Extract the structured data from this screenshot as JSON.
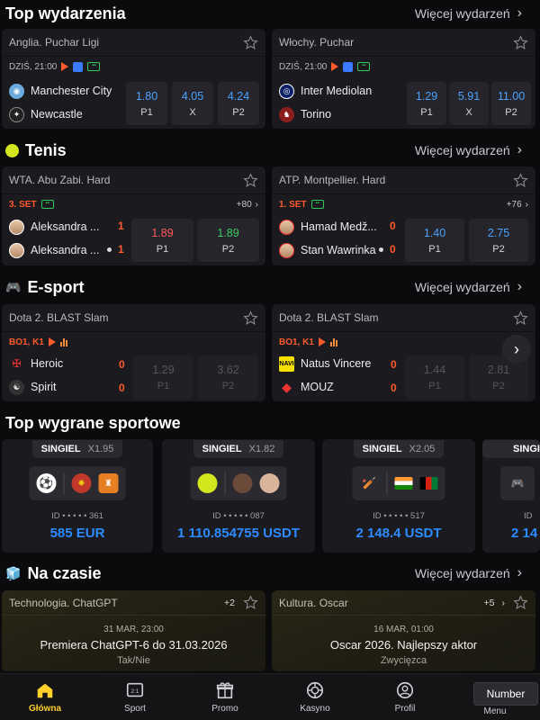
{
  "top_events": {
    "title": "Top wydarzenia",
    "more": "Więcej wydarzeń",
    "matches": [
      {
        "league": "Anglia. Puchar Ligi",
        "date": "DZIŚ, 21:00",
        "home": "Manchester City",
        "away": "Newcastle",
        "odds": [
          {
            "v": "1.80",
            "l": "P1"
          },
          {
            "v": "4.05",
            "l": "X"
          },
          {
            "v": "4.24",
            "l": "P2"
          }
        ]
      },
      {
        "league": "Włochy. Puchar",
        "date": "DZIŚ, 21:00",
        "home": "Inter Mediolan",
        "away": "Torino",
        "odds": [
          {
            "v": "1.29",
            "l": "P1"
          },
          {
            "v": "5.91",
            "l": "X"
          },
          {
            "v": "11.00",
            "l": "P2"
          }
        ]
      }
    ]
  },
  "tennis": {
    "title": "Tenis",
    "more": "Więcej wydarzeń",
    "matches": [
      {
        "league": "WTA. Abu Zabi. Hard",
        "set": "3. SET",
        "plus": "+80",
        "p1": "Aleksandra ...",
        "p2": "Aleksandra ...",
        "s1": "1",
        "s2": "1",
        "odds": [
          {
            "v": "1.89",
            "l": "P1"
          },
          {
            "v": "1.89",
            "l": "P2"
          }
        ]
      },
      {
        "league": "ATP. Montpellier. Hard",
        "set": "1. SET",
        "plus": "+76",
        "p1": "Hamad Medž...",
        "p2": "Stan Wawrinka",
        "s1": "0",
        "s2": "0",
        "odds": [
          {
            "v": "1.40",
            "l": "P1"
          },
          {
            "v": "2.75",
            "l": "P2"
          }
        ]
      }
    ]
  },
  "esport": {
    "title": "E-sport",
    "more": "Więcej wydarzeń",
    "matches": [
      {
        "league": "Dota 2. BLAST Slam",
        "live": "BO1, K1",
        "t1": "Heroic",
        "t2": "Spirit",
        "s1": "0",
        "s2": "0",
        "odds": [
          {
            "v": "1.29",
            "l": "P1"
          },
          {
            "v": "3.62",
            "l": "P2"
          }
        ]
      },
      {
        "league": "Dota 2. BLAST Slam",
        "live": "BO1, K1",
        "t1": "Natus Vincere",
        "t2": "MOUZ",
        "s1": "0",
        "s2": "0",
        "odds": [
          {
            "v": "1.44",
            "l": "P1"
          },
          {
            "v": "2.81",
            "l": "P2"
          }
        ]
      }
    ]
  },
  "top_wins": {
    "title": "Top wygrane sportowe",
    "cards": [
      {
        "type": "SINGIEL",
        "mult": "X1.95",
        "id": "ID • • • • • 361",
        "amount": "585 EUR"
      },
      {
        "type": "SINGIEL",
        "mult": "X1.82",
        "id": "ID • • • • • 087",
        "amount": "1 110.854755 USDT"
      },
      {
        "type": "SINGIEL",
        "mult": "X2.05",
        "id": "ID • • • • • 517",
        "amount": "2 148.4 USDT"
      },
      {
        "type": "SINGI",
        "mult": "",
        "id": "ID",
        "amount": "2 14"
      }
    ]
  },
  "trending": {
    "title": "Na czasie",
    "more": "Więcej wydarzeń",
    "cards": [
      {
        "league": "Technologia. ChatGPT",
        "plus": "+2",
        "when": "31 MAR, 23:00",
        "question": "Premiera ChatGPT-6 do 31.03.2026",
        "option": "Tak/Nie"
      },
      {
        "league": "Kultura. Oscar",
        "plus": "+5",
        "when": "16 MAR, 01:00",
        "question": "Oscar  2026. Najlepszy aktor",
        "option": "Zwycięzca"
      }
    ]
  },
  "nav": {
    "items": [
      {
        "label": "Główna",
        "icon": "home-icon"
      },
      {
        "label": "Sport",
        "icon": "scoreboard-icon"
      },
      {
        "label": "Promo",
        "icon": "gift-icon"
      },
      {
        "label": "Kasyno",
        "icon": "casino-chip-icon"
      },
      {
        "label": "Profil",
        "icon": "user-icon"
      },
      {
        "label": "Menu",
        "icon": "menu-icon"
      }
    ],
    "tooltip": "Number"
  },
  "colors": {
    "accent": "#ffd12a",
    "odds": "#4aa3ff",
    "live": "#ff5a2b",
    "win": "#2c8cff"
  }
}
